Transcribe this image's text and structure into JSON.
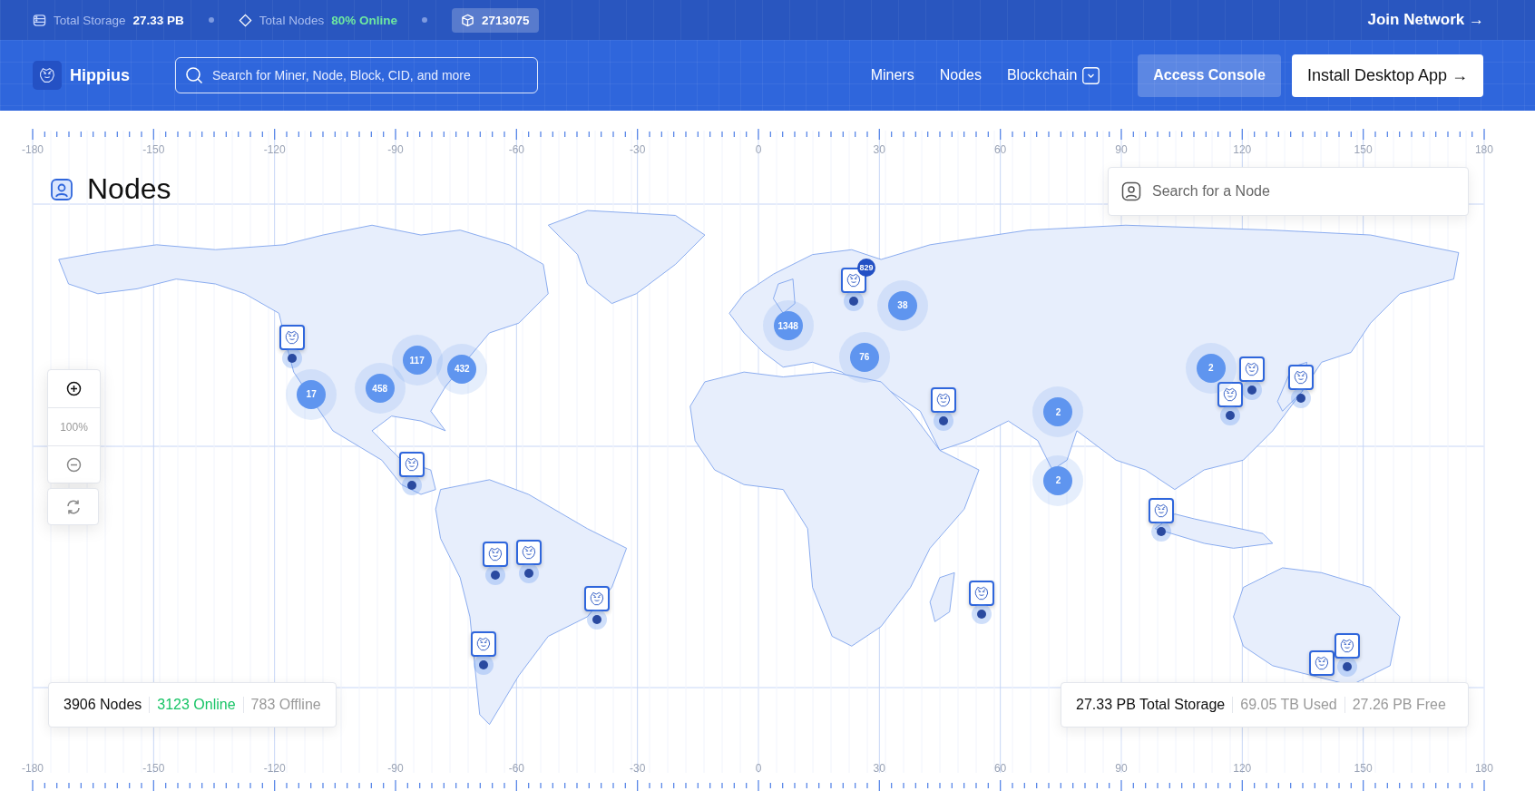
{
  "top_bar": {
    "stats": [
      {
        "kind": "storage",
        "label": "Total Storage",
        "value": "27.33 PB"
      },
      {
        "kind": "nodes",
        "label": "Total Nodes",
        "value": "80% Online"
      }
    ],
    "block": "2713075",
    "join_link": "Join Network →"
  },
  "nav": {
    "brand": "Hippius",
    "search": {
      "placeholder": "Search for Miner, Node, Block, CID, and more"
    },
    "links": [
      {
        "label": "Miners",
        "dropdown": false
      },
      {
        "label": "Nodes",
        "dropdown": false
      },
      {
        "label": "Blockchain",
        "dropdown": true
      }
    ],
    "console_button": "Access Console",
    "install_button": "Install Desktop App →"
  },
  "map": {
    "title": "Nodes",
    "search": {
      "placeholder": "Search for a Node"
    },
    "zoom_level": "100%",
    "top_axis": [
      "-180",
      "-150",
      "-120",
      "-90",
      "-60",
      "-30",
      "0",
      "30",
      "60",
      "90",
      "120",
      "150",
      "180"
    ],
    "bottom_axis": [
      "-180",
      "-150",
      "-120",
      "-90",
      "-60",
      "-30",
      "0",
      "30",
      "60",
      "90",
      "120",
      "150",
      "180"
    ],
    "clusters": [
      {
        "kind": "cluster",
        "count": "17"
      },
      {
        "kind": "cluster",
        "count": "458"
      },
      {
        "kind": "cluster",
        "count": "117"
      },
      {
        "kind": "cluster",
        "count": "432"
      },
      {
        "kind": "badge",
        "count": "829"
      },
      {
        "kind": "cluster",
        "count": "1348"
      },
      {
        "kind": "cluster",
        "count": "38"
      },
      {
        "kind": "cluster",
        "count": "76"
      },
      {
        "kind": "cluster",
        "count": "2"
      },
      {
        "kind": "cluster",
        "count": "2"
      },
      {
        "kind": "cluster",
        "count": "2"
      }
    ],
    "node_stats": [
      {
        "kind": "total",
        "text": "3906 Nodes"
      },
      {
        "kind": "online",
        "text": "3123 Online"
      },
      {
        "kind": "muted",
        "text": "783 Offline"
      }
    ],
    "storage_stats": [
      {
        "kind": "total",
        "text": "27.33 PB Total Storage"
      },
      {
        "kind": "muted",
        "text": "69.05 TB Used"
      },
      {
        "kind": "muted",
        "text": "27.26 PB Free"
      }
    ]
  }
}
